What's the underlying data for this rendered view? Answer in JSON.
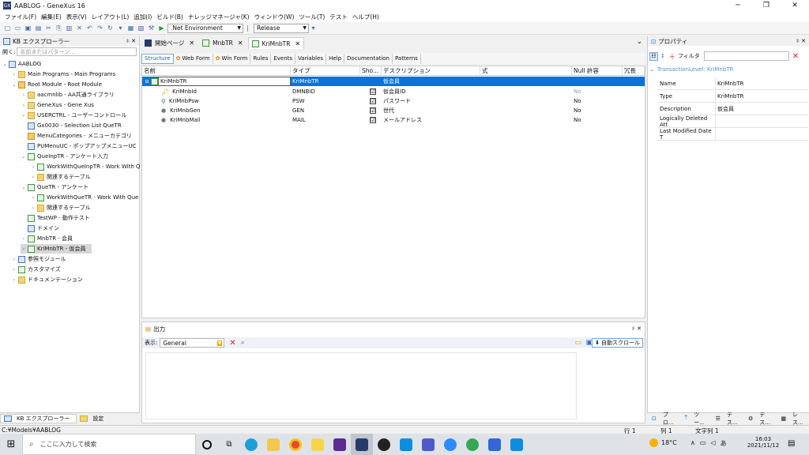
{
  "window": {
    "title": "AABLOG - GeneXus 16",
    "app_icon": "GX"
  },
  "menu": [
    "ファイル(F)",
    "編集(E)",
    "表示(V)",
    "レイアウト(L)",
    "追加(I)",
    "ビルド(B)",
    "ナレッジマネージャ(K)",
    "ウィンドウ(W)",
    "ツール(T)",
    "テスト",
    "ヘルプ(H)"
  ],
  "toolbar": {
    "environment": ".Net Environment",
    "configuration": "Release"
  },
  "kb": {
    "title": "KB エクスプローラー",
    "search_label": "開く:",
    "search_placeholder": "名前またはパターン...",
    "items": [
      {
        "label": "AABLOG"
      },
      {
        "label": "Main Programs - Main Programs"
      },
      {
        "label": "Root Module - Root Module"
      },
      {
        "label": "aacmnlib - AA共通ライブラリ"
      },
      {
        "label": "GeneXus - Gene Xus"
      },
      {
        "label": "USERCTRL - ユーザーコントロール"
      },
      {
        "label": "Gx0030 - Selection List QueTR"
      },
      {
        "label": "MenuCategories - メニューカテゴリ"
      },
      {
        "label": "PUMenuUC - ポップアップメニューUC"
      },
      {
        "label": "QueInpTR - アンケート入力"
      },
      {
        "label": "WorkWithQueInpTR - Work With Q"
      },
      {
        "label": "関連するテーブル"
      },
      {
        "label": "QueTR - アンケート"
      },
      {
        "label": "WorkWithQueTR - Work With Que"
      },
      {
        "label": "関連するテーブル"
      },
      {
        "label": "TestWP - 動作テスト"
      },
      {
        "label": "ドメイン"
      },
      {
        "label": "MnbTR - 会員"
      },
      {
        "label": "KriMnbTR - 仮会員"
      },
      {
        "label": "参照モジュール"
      },
      {
        "label": "カスタマイズ"
      },
      {
        "label": "ドキュメンテーション"
      }
    ],
    "bottom_tabs": [
      "KB エクスプローラー",
      "設定"
    ]
  },
  "doc_tabs": [
    "開始ページ",
    "MnbTR",
    "KriMnbTR"
  ],
  "sub_tabs": [
    "Structure",
    "Web Form",
    "Win Form",
    "Rules",
    "Events",
    "Variables",
    "Help",
    "Documentation",
    "Patterns"
  ],
  "grid": {
    "headers": [
      "名前",
      "タイプ",
      "Sho...",
      "デスクリプション",
      "式",
      "Null 許容",
      "冗長"
    ],
    "rows": [
      {
        "name": "KriMnbTR",
        "type": "KriMnbTR",
        "show": "",
        "desc": "仮会員",
        "nullable": ""
      },
      {
        "name": "KriMnbId",
        "type": "DMNBID",
        "show": "☑",
        "desc": "仮会員ID",
        "nullable": "No"
      },
      {
        "name": "KriMnbPsw",
        "type": "PSW",
        "show": "☑",
        "desc": "パスワード",
        "nullable": "No"
      },
      {
        "name": "KriMnbGen",
        "type": "GEN",
        "show": "☑",
        "desc": "世代",
        "nullable": "No"
      },
      {
        "name": "KriMnbMail",
        "type": "MAIL",
        "show": "☑",
        "desc": "メールアドレス",
        "nullable": "No"
      }
    ]
  },
  "output": {
    "title": "出力",
    "show_label": "表示:",
    "source": "General",
    "autoscroll": "自動スクロール"
  },
  "props": {
    "title": "プロパティ",
    "filter": "フィルタ",
    "level": "TransactionLevel: KriMnbTR",
    "rows": [
      {
        "k": "Name",
        "v": "KriMnbTR"
      },
      {
        "k": "Type",
        "v": "KriMnbTR"
      },
      {
        "k": "Description",
        "v": "仮会員"
      },
      {
        "k": "Logically Deleted Att",
        "v": ""
      },
      {
        "k": "Last Modified Date T",
        "v": ""
      }
    ],
    "bottom_tabs": [
      "プロ...",
      "ツー...",
      "テス...",
      "テス...",
      "レス..."
    ]
  },
  "status": {
    "path": "C:¥Models¥AABLOG",
    "line": "行 1",
    "col": "列 1",
    "char": "文字列 1"
  },
  "taskbar": {
    "search": "ここに入力して検索",
    "temp": "18°C",
    "time": "16:03",
    "date": "2021/11/12"
  }
}
